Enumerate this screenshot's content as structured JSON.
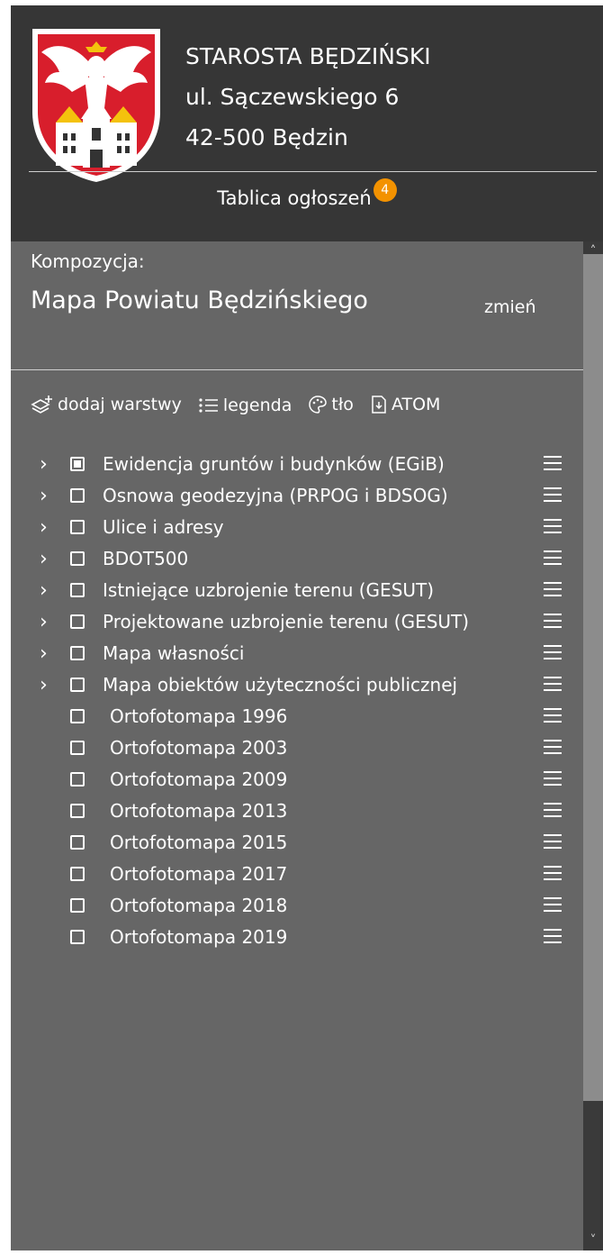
{
  "header": {
    "crest_icon": "bedzin-coat-of-arms",
    "office_lines": [
      "STAROSTA BĘDZIŃSKI",
      "ul. Sączewskiego 6",
      "42-500 Będzin"
    ],
    "board_label": "Tablica ogłoszeń",
    "board_badge": "4",
    "badge_color": "#f39200"
  },
  "composition": {
    "label": "Kompozycja:",
    "name": "Mapa Powiatu Będzińskiego",
    "change_label": "zmień"
  },
  "toolbar": {
    "add_layers": "dodaj warstwy",
    "legend": "legenda",
    "background": "tło",
    "atom": "ATOM"
  },
  "layers": [
    {
      "label": "Ewidencja gruntów i budynków (EGiB)",
      "expandable": true,
      "state": "partial"
    },
    {
      "label": "Osnowa geodezyjna (PRPOG i BDSOG)",
      "expandable": true,
      "state": "unchecked"
    },
    {
      "label": "Ulice i adresy",
      "expandable": true,
      "state": "unchecked"
    },
    {
      "label": "BDOT500",
      "expandable": true,
      "state": "unchecked"
    },
    {
      "label": "Istniejące uzbrojenie terenu (GESUT)",
      "expandable": true,
      "state": "unchecked"
    },
    {
      "label": "Projektowane uzbrojenie terenu (GESUT)",
      "expandable": true,
      "state": "unchecked"
    },
    {
      "label": "Mapa własności",
      "expandable": true,
      "state": "unchecked"
    },
    {
      "label": "Mapa obiektów użyteczności publicznej",
      "expandable": true,
      "state": "unchecked"
    },
    {
      "label": "Ortofotomapa 1996",
      "expandable": false,
      "state": "unchecked"
    },
    {
      "label": "Ortofotomapa 2003",
      "expandable": false,
      "state": "unchecked"
    },
    {
      "label": "Ortofotomapa 2009",
      "expandable": false,
      "state": "unchecked"
    },
    {
      "label": "Ortofotomapa 2013",
      "expandable": false,
      "state": "unchecked"
    },
    {
      "label": "Ortofotomapa 2015",
      "expandable": false,
      "state": "unchecked"
    },
    {
      "label": "Ortofotomapa 2017",
      "expandable": false,
      "state": "unchecked"
    },
    {
      "label": "Ortofotomapa 2018",
      "expandable": false,
      "state": "unchecked"
    },
    {
      "label": "Ortofotomapa 2019",
      "expandable": false,
      "state": "unchecked"
    }
  ],
  "icons": {
    "expand": "chevron-right-icon",
    "layer_menu": "hamburger-menu-icon",
    "add_layers": "add-layers-icon",
    "legend": "list-icon",
    "background": "palette-icon",
    "atom": "download-file-icon"
  },
  "colors": {
    "header_bg": "#363636",
    "panel_bg": "#666666",
    "text": "#ffffff"
  }
}
